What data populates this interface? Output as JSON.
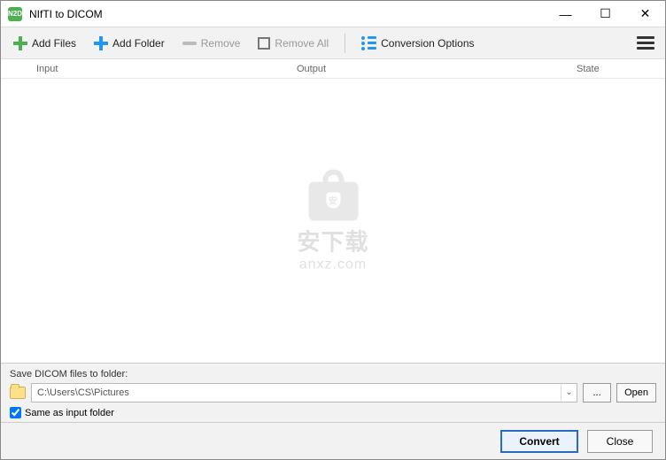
{
  "title": "NIfTI to DICOM",
  "app_icon_text": "N2D",
  "toolbar": {
    "add_files": "Add Files",
    "add_folder": "Add Folder",
    "remove": "Remove",
    "remove_all": "Remove All",
    "conversion_options": "Conversion Options"
  },
  "columns": {
    "input": "Input",
    "output": "Output",
    "state": "State"
  },
  "watermark": {
    "cn": "安下载",
    "en": "anxz.com"
  },
  "save": {
    "label": "Save DICOM files to folder:",
    "path": "C:\\Users\\CS\\Pictures",
    "browse": "...",
    "open": "Open",
    "same_as_input": "Same as input folder",
    "same_checked": true
  },
  "actions": {
    "convert": "Convert",
    "close": "Close"
  }
}
